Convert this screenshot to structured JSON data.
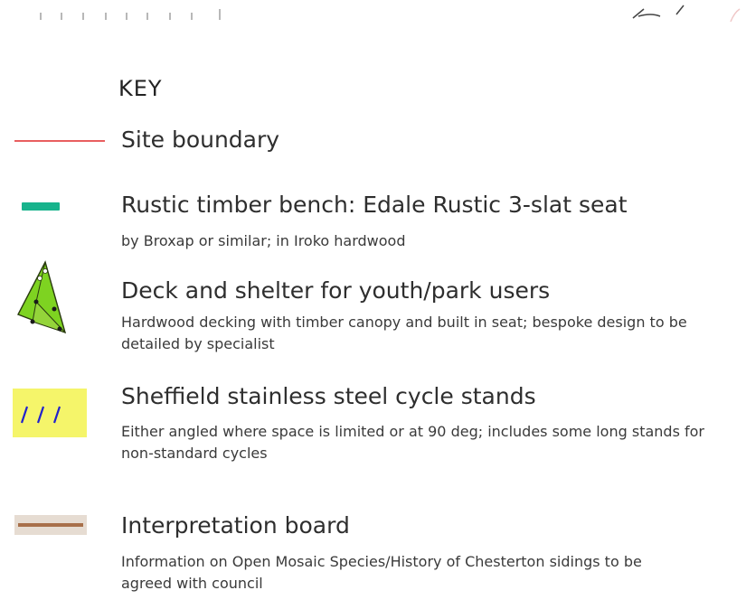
{
  "legend": {
    "title": "KEY",
    "entries": [
      {
        "id": "site-boundary",
        "symbol": "red-line",
        "color": "#e0282a",
        "title": "Site boundary",
        "description": ""
      },
      {
        "id": "rustic-bench",
        "symbol": "teal-bar",
        "color": "#17b38c",
        "title": "Rustic timber bench: Edale Rustic 3-slat seat",
        "description": "by Broxap or similar; in Iroko hardwood"
      },
      {
        "id": "deck-shelter",
        "symbol": "green-triangle",
        "color": "#7ed321",
        "title": "Deck and shelter for youth/park users",
        "description": "Hardwood decking with timber canopy and built in seat; bespoke design to be detailed by specialist"
      },
      {
        "id": "cycle-stands",
        "symbol": "yellow-hatched",
        "color": "#f5f56a",
        "title": "Sheffield stainless steel cycle stands",
        "description": "Either angled where space is limited or at 90 deg; includes some long stands for non-standard cycles"
      },
      {
        "id": "interpretation-board",
        "symbol": "brown-bar",
        "color": "#b58a6a",
        "title": "Interpretation board",
        "description": "Information on Open Mosaic Species/History of Chesterton sidings to be agreed with council"
      }
    ]
  }
}
